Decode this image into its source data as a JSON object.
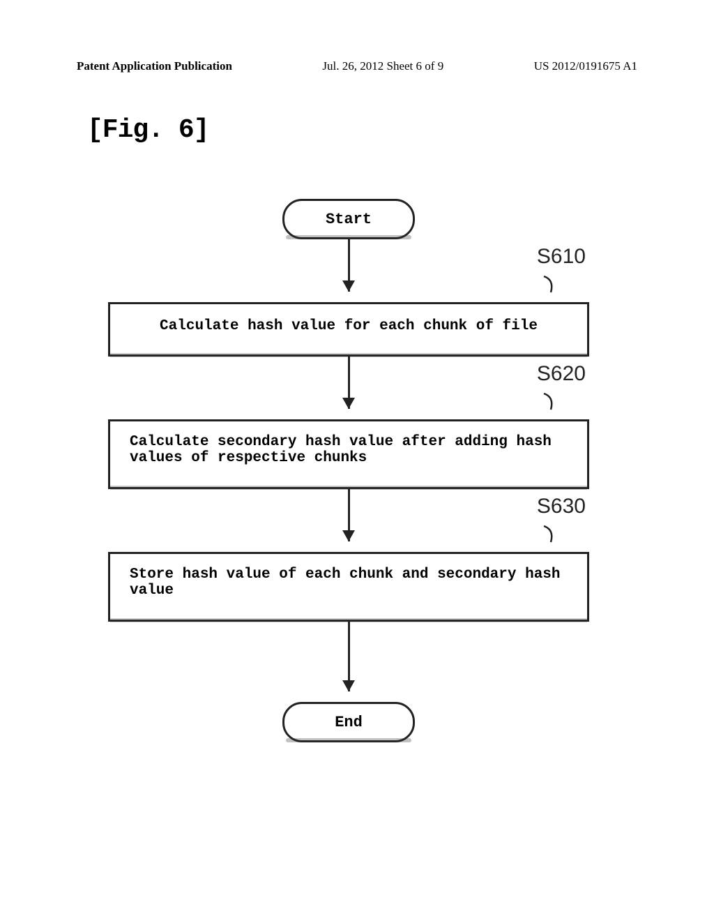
{
  "header": {
    "left": "Patent Application Publication",
    "center": "Jul. 26, 2012  Sheet 6 of 9",
    "right": "US 2012/0191675 A1"
  },
  "figure_label": "[Fig. 6]",
  "flowchart": {
    "start": "Start",
    "end": "End",
    "steps": [
      {
        "label": "S610",
        "text": "Calculate hash value for each chunk of file"
      },
      {
        "label": "S620",
        "text": "Calculate secondary hash value after adding hash values of respective chunks"
      },
      {
        "label": "S630",
        "text": "Store hash value of each chunk and secondary hash value"
      }
    ]
  },
  "chart_data": {
    "type": "flowchart",
    "nodes": [
      {
        "id": "start",
        "type": "terminal",
        "label": "Start"
      },
      {
        "id": "s610",
        "type": "process",
        "label": "Calculate hash value for each chunk of file",
        "ref": "S610"
      },
      {
        "id": "s620",
        "type": "process",
        "label": "Calculate secondary hash value after adding hash values of respective chunks",
        "ref": "S620"
      },
      {
        "id": "s630",
        "type": "process",
        "label": "Store hash value of each chunk and secondary hash value",
        "ref": "S630"
      },
      {
        "id": "end",
        "type": "terminal",
        "label": "End"
      }
    ],
    "edges": [
      {
        "from": "start",
        "to": "s610"
      },
      {
        "from": "s610",
        "to": "s620"
      },
      {
        "from": "s620",
        "to": "s630"
      },
      {
        "from": "s630",
        "to": "end"
      }
    ]
  }
}
